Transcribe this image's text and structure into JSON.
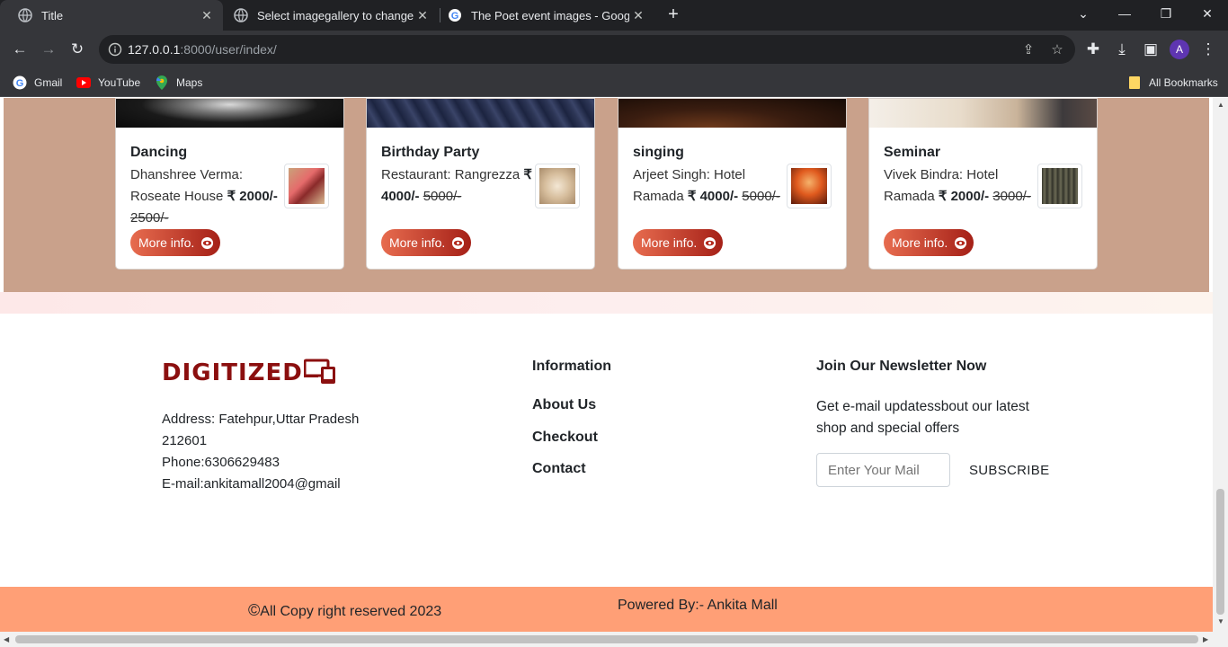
{
  "browser": {
    "tabs": [
      {
        "title": "Title",
        "icon": "globe-icon",
        "active": true
      },
      {
        "title": "Select imagegallery to change | D",
        "icon": "globe-icon",
        "active": false
      },
      {
        "title": "The Poet event images - Google",
        "icon": "google-icon",
        "active": false
      }
    ],
    "url_host": "127.0.0.1",
    "url_rest": ":8000/user/index/",
    "avatar_letter": "A",
    "bookmarks": [
      {
        "label": "Gmail",
        "icon": "google-icon"
      },
      {
        "label": "YouTube",
        "icon": "youtube-icon"
      },
      {
        "label": "Maps",
        "icon": "maps-icon"
      }
    ],
    "all_bookmarks": "All Bookmarks"
  },
  "events": [
    {
      "title": "Dancing",
      "desc": "Dhanshree Verma: Roseate House",
      "price": "₹ 2000/-",
      "old_price": "2500/-",
      "button": "More info."
    },
    {
      "title": "Birthday Party",
      "desc": "Restaurant: Rangrezza",
      "price": "₹ 4000/-",
      "old_price": "5000/-",
      "button": "More info."
    },
    {
      "title": "singing",
      "desc": "Arjeet Singh: Hotel Ramada",
      "price": "₹ 4000/-",
      "old_price": "5000/-",
      "button": "More info."
    },
    {
      "title": "Seminar",
      "desc": "Vivek Bindra: Hotel Ramada",
      "price": "₹ 2000/-",
      "old_price": "3000/-",
      "button": "More info."
    }
  ],
  "footer": {
    "logo": "DIGITIZED",
    "address_line1": "Address: Fatehpur,Uttar Pradesh",
    "address_line2": "212601",
    "phone": "Phone:6306629483",
    "email": "E-mail:ankitamall2004@gmail",
    "info_heading": "Information",
    "links": [
      "About Us",
      "Checkout",
      "Contact"
    ],
    "newsletter_heading": "Join Our Newsletter Now",
    "newsletter_text": "Get e-mail updatessbout our latest shop and special offers",
    "email_placeholder": "Enter Your Mail",
    "subscribe": "SUBSCRIBE",
    "copyright": "All Copy right reserved 2023",
    "copyright_symbol": "©",
    "powered_by": "Powered By:- Ankita Mall"
  },
  "colors": {
    "band": "#c9a18b",
    "brand": "#8b0f0f",
    "footer_bottom": "#ff9f76",
    "button_start": "#e76c4f",
    "button_end": "#a52017"
  }
}
